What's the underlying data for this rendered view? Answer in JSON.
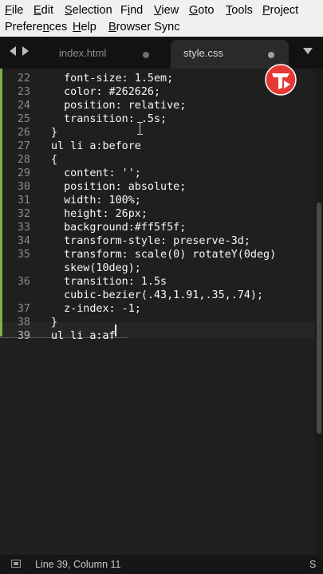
{
  "menu": {
    "file": {
      "u": "F",
      "rest": "ile"
    },
    "edit": {
      "u": "E",
      "rest": "dit"
    },
    "selection": {
      "u": "S",
      "rest": "election"
    },
    "find": {
      "pre": "F",
      "u": "i",
      "rest": "nd"
    },
    "view": {
      "u": "V",
      "rest": "iew"
    },
    "goto": {
      "u": "G",
      "rest": "oto"
    },
    "tools": {
      "u": "T",
      "rest": "ools"
    },
    "project": {
      "u": "P",
      "rest": "roject"
    },
    "preferences": {
      "pre": "Prefere",
      "u": "n",
      "rest": "ces"
    },
    "help": {
      "u": "H",
      "rest": "elp"
    },
    "browser_sync": {
      "u": "B",
      "rest": "rowser Sync"
    }
  },
  "tabs": [
    {
      "label": "index.html",
      "active": false
    },
    {
      "label": "style.css",
      "active": true
    }
  ],
  "editor": {
    "lines": [
      {
        "num": "22",
        "code": "  font-size: 1.5em;"
      },
      {
        "num": "23",
        "code": "  color: #262626;"
      },
      {
        "num": "24",
        "code": "  position: relative;"
      },
      {
        "num": "25",
        "code": "  transition: .5s;"
      },
      {
        "num": "26",
        "code": "}"
      },
      {
        "num": "27",
        "code": "ul li a:before"
      },
      {
        "num": "28",
        "code": "{"
      },
      {
        "num": "29",
        "code": "  content: '';"
      },
      {
        "num": "30",
        "code": "  position: absolute;"
      },
      {
        "num": "31",
        "code": "  width: 100%;"
      },
      {
        "num": "32",
        "code": "  height: 26px;"
      },
      {
        "num": "33",
        "code": "  background:#ff5f5f;"
      },
      {
        "num": "34",
        "code": "  transform-style: preserve-3d;"
      },
      {
        "num": "35",
        "code": "  transform: scale(0) rotateY(0deg)"
      },
      {
        "num": "",
        "code": "  skew(10deg);"
      },
      {
        "num": "36",
        "code": "  transition: 1.5s"
      },
      {
        "num": "",
        "code": "  cubic-bezier(.43,1.91,.35,.74);"
      },
      {
        "num": "37",
        "code": "  z-index: -1;"
      },
      {
        "num": "38",
        "code": "}"
      },
      {
        "num": "39",
        "code": "ul li a:af"
      }
    ]
  },
  "status": {
    "position": "Line 39, Column 11",
    "right": "S"
  },
  "colors": {
    "accent_bar": "#7cb342",
    "logo_red": "#e53935"
  }
}
